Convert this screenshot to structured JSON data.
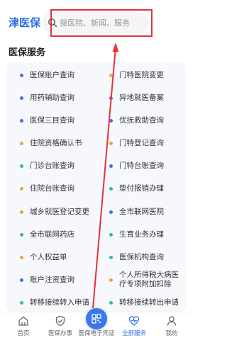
{
  "header": {
    "logo": "津医保",
    "search_placeholder": "搜医院、新闻、服务"
  },
  "section": {
    "title": "医保服务"
  },
  "services": {
    "left": [
      {
        "label": "医保账户查询",
        "dot": "#3b73e0"
      },
      {
        "label": "用药辅助查询",
        "dot": "#3b73e0"
      },
      {
        "label": "医保三目查询",
        "dot": "#3b73e0"
      },
      {
        "label": "住院资格确认书",
        "dot": "#f2a33a"
      },
      {
        "label": "门诊台账查询",
        "dot": "#2fb8b0"
      },
      {
        "label": "住院台账查询",
        "dot": "#f2a33a"
      },
      {
        "label": "城乡就医登记变更",
        "dot": "#f2a33a"
      },
      {
        "label": "全市联网药店",
        "dot": "#2fb8b0"
      },
      {
        "label": "个人权益单",
        "dot": "#f2a33a"
      },
      {
        "label": "账户注资查询",
        "dot": "#3b73e0"
      },
      {
        "label": "转移接续转入申请",
        "dot": "#2fb8b0"
      }
    ],
    "right": [
      {
        "label": "门特医院变更",
        "dot": "#f2a33a"
      },
      {
        "label": "异地就医备案",
        "dot": "#3b73e0"
      },
      {
        "label": "优抚救助查询",
        "dot": "#3b73e0"
      },
      {
        "label": "门特登记查询",
        "dot": "#f2a33a"
      },
      {
        "label": "门特台账查询",
        "dot": "#3b73e0"
      },
      {
        "label": "垫付报销办理",
        "dot": "#2fb8b0"
      },
      {
        "label": "全市联网医院",
        "dot": "#3b73e0"
      },
      {
        "label": "生育业务办理",
        "dot": "#2fb8b0"
      },
      {
        "label": "医保机构查询",
        "dot": "#2fb8b0"
      },
      {
        "label": "个人所得税大病医疗专项附加扣除",
        "dot": "#f2a33a"
      },
      {
        "label": "转移接续转出申请",
        "dot": "#2fb8b0"
      }
    ]
  },
  "tabbar": {
    "tabs": [
      {
        "label": "首页",
        "icon": "home-icon"
      },
      {
        "label": "医保办事",
        "icon": "shield-check-icon"
      },
      {
        "label": "医保电子凭证",
        "icon": "qr-code-icon"
      },
      {
        "label": "全部服务",
        "icon": "heart-pulse-icon"
      },
      {
        "label": "我的",
        "icon": "user-icon"
      }
    ],
    "active_index": 3
  },
  "colors": {
    "brand": "#2b6fe6",
    "annotation": "#e5323b",
    "card_bg": "#f6f8fc"
  }
}
